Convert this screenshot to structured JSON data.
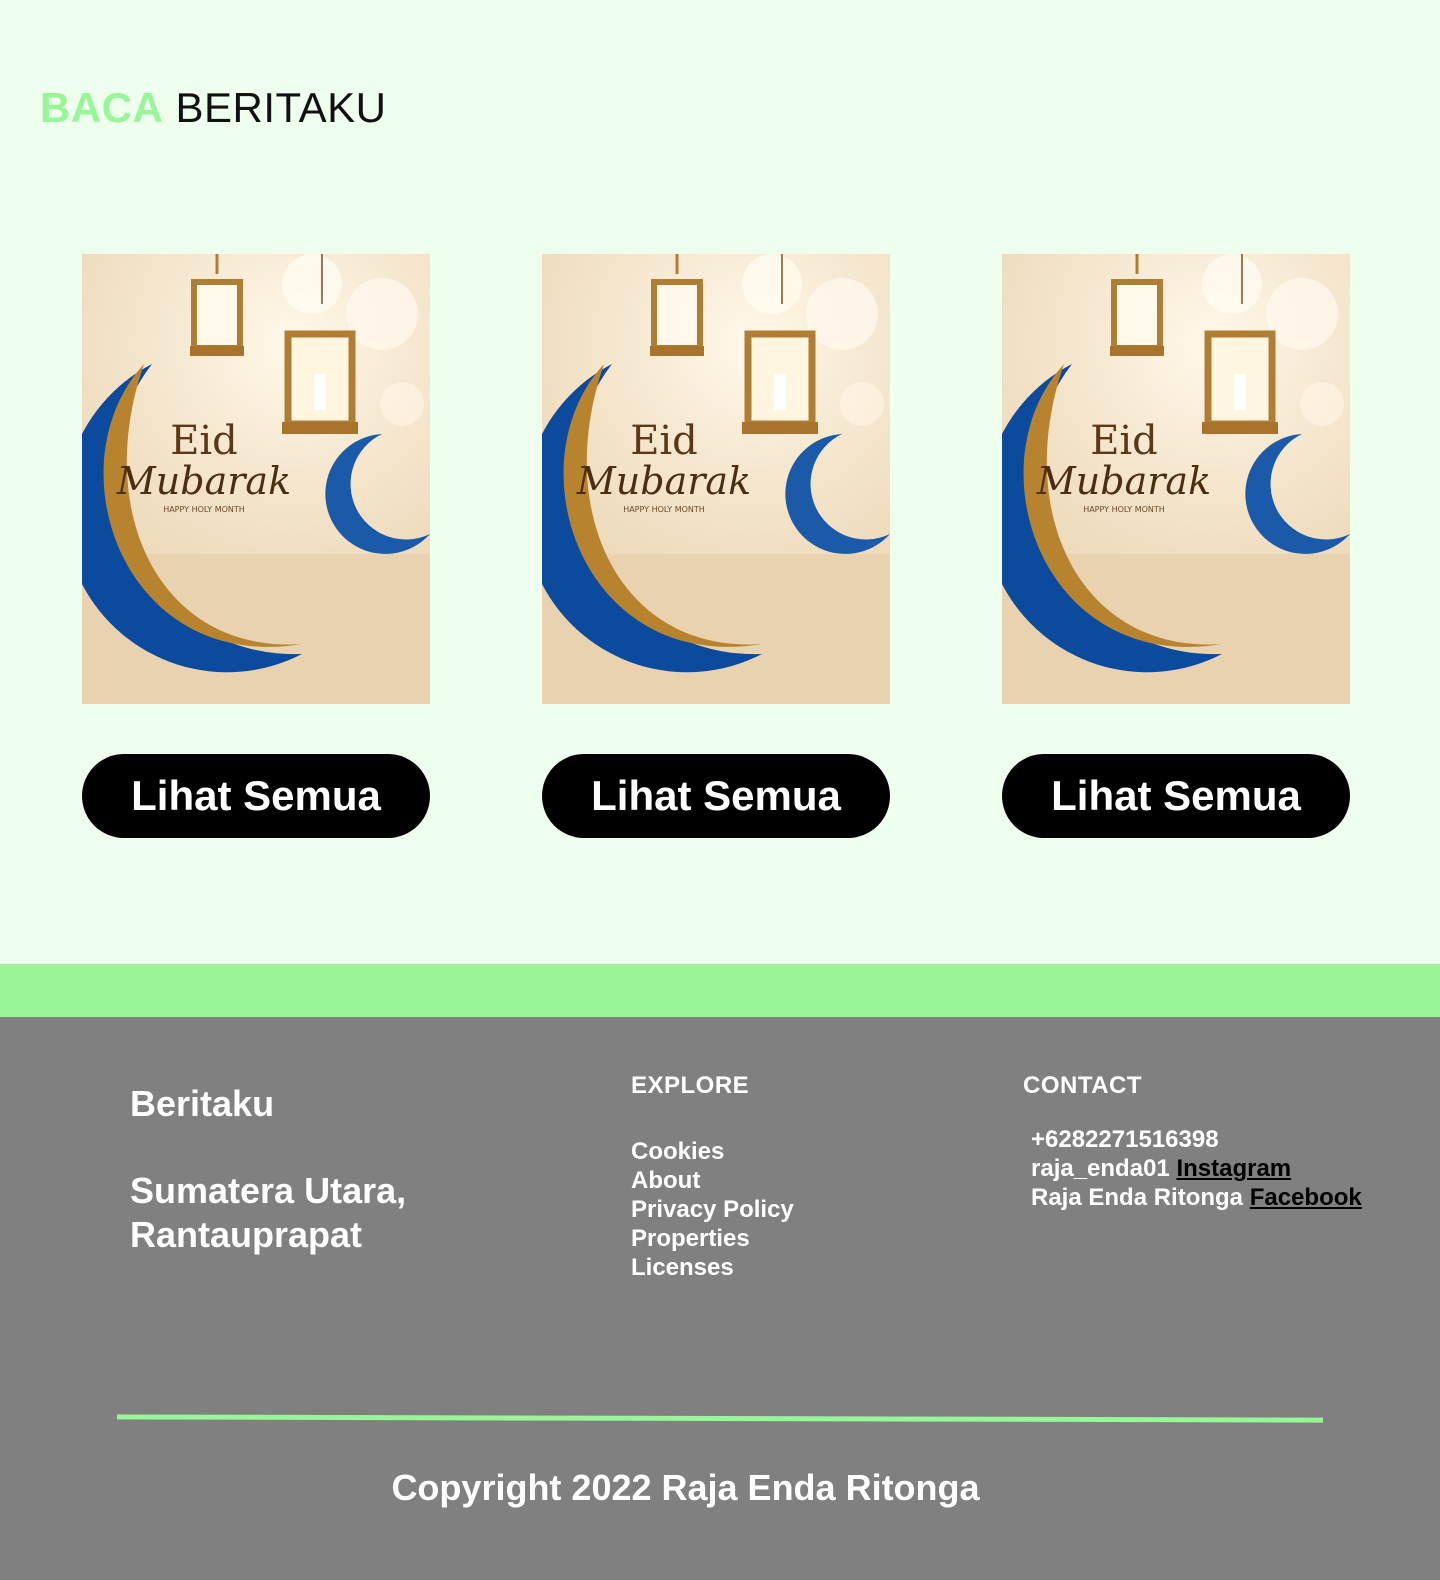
{
  "header": {
    "logo_accent": "BACA",
    "logo_rest": "BERITAKU"
  },
  "cards": [
    {
      "image_title": "Eid",
      "image_script": "Mubarak",
      "image_sub": "HAPPY HOLY MONTH",
      "button_label": "Lihat Semua"
    },
    {
      "image_title": "Eid",
      "image_script": "Mubarak",
      "image_sub": "HAPPY HOLY MONTH",
      "button_label": "Lihat Semua"
    },
    {
      "image_title": "Eid",
      "image_script": "Mubarak",
      "image_sub": "HAPPY HOLY MONTH",
      "button_label": "Lihat Semua"
    }
  ],
  "footer": {
    "brand": "Beritaku",
    "address_line1": "Sumatera Utara,",
    "address_line2": "Rantauprapat",
    "explore_title": "EXPLORE",
    "explore_links": [
      "Cookies",
      "About",
      "Privacy Policy",
      "Properties",
      "Licenses"
    ],
    "contact_title": "CONTACT",
    "phone": "+6282271516398",
    "instagram_handle": "raja_enda01",
    "instagram_label": "Instagram",
    "facebook_name": "Raja Enda Ritonga",
    "facebook_label": "Facebook",
    "copyright": "Copyright 2022 Raja Enda Ritonga"
  },
  "colors": {
    "page_bg": "#efffee",
    "accent_green": "#98f598",
    "footer_bg": "#808080",
    "button_bg": "#000000"
  }
}
